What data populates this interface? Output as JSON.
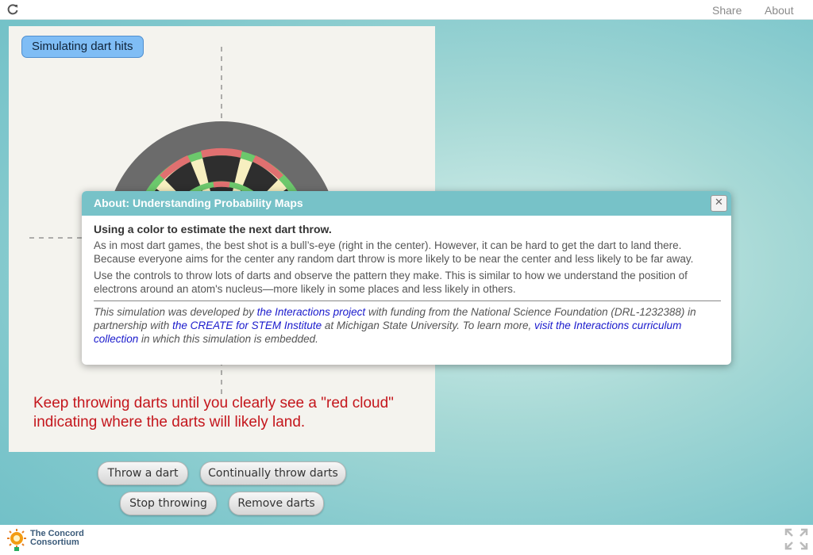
{
  "topbar": {
    "share_label": "Share",
    "about_label": "About"
  },
  "simulation": {
    "title": "Simulating dart hits",
    "instruction": "Keep throwing darts until you clearly see a \"red cloud\" indicating where the darts will likely land."
  },
  "buttons": {
    "throw_one": "Throw a dart",
    "throw_continuous": "Continually throw darts",
    "stop": "Stop throwing",
    "remove": "Remove darts"
  },
  "dialog": {
    "title": "About: Understanding Probability Maps",
    "close_label": "✕",
    "heading": "Using a color to estimate the next dart throw.",
    "paragraph1": "As in most dart games, the best shot is a bull’s-eye (right in the center). However, it can be hard to get the dart to land there. Because everyone aims for the center any random dart throw is more likely to be near the center and less likely to be far away.",
    "paragraph2": "Use the controls to throw lots of darts and observe the pattern they make. This is similar to how we understand the position of electrons around an atom's nucleus—more likely in some places and less likely in others.",
    "credits": {
      "t1": "This simulation was developed by ",
      "link1": "the Interactions project",
      "t2": " with funding from the National Science Foundation (DRL-1232388) in partnership with ",
      "link2": "the CREATE for STEM Institute",
      "t3": " at Michigan State University. To learn more, ",
      "link3": "visit the Interactions curriculum collection",
      "t4": " in which this simulation is embedded."
    }
  },
  "footer": {
    "logo_line1": "The Concord",
    "logo_line2": "Consortium"
  },
  "colors": {
    "accent": "#77c2c8",
    "instruction": "#c4161c",
    "link": "#1a1acc",
    "board_red": "#e07070",
    "board_green": "#6cc86c",
    "board_cream": "#f7efc0",
    "board_rim": "#6b6b6b"
  }
}
